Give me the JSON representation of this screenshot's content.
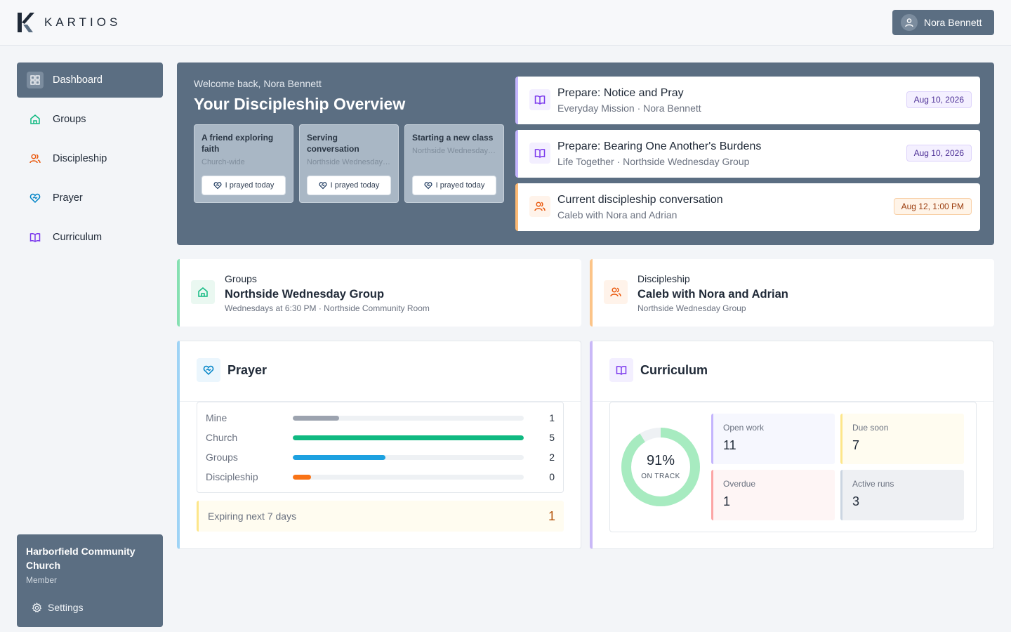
{
  "brand": {
    "name": "KARTIOS"
  },
  "user": {
    "name": "Nora Bennett"
  },
  "sidebar": {
    "items": [
      {
        "label": "Dashboard",
        "icon": "dashboard-icon",
        "active": true
      },
      {
        "label": "Groups",
        "icon": "home-icon"
      },
      {
        "label": "Discipleship",
        "icon": "users-icon"
      },
      {
        "label": "Prayer",
        "icon": "heart-hands-icon"
      },
      {
        "label": "Curriculum",
        "icon": "book-icon"
      }
    ],
    "org": {
      "name": "Harborfield Community Church",
      "role": "Member",
      "settings_label": "Settings"
    }
  },
  "hero": {
    "welcome": "Welcome back, Nora Bennett",
    "title": "Your Discipleship Overview",
    "prayer_cards": [
      {
        "title": "A friend exploring faith",
        "sub": "Church-wide",
        "button": "I prayed today"
      },
      {
        "title": "Serving conversation",
        "sub": "Northside Wednesday Group",
        "button": "I prayed today"
      },
      {
        "title": "Starting a new class",
        "sub": "Northside Wednesday Group",
        "button": "I prayed today"
      }
    ],
    "events": [
      {
        "title": "Prepare: Notice and Pray",
        "sub": "Everyday Mission · Nora Bennett",
        "date": "Aug 10, 2026"
      },
      {
        "title": "Prepare: Bearing One Another's Burdens",
        "sub": "Life Together · Northside Wednesday Group",
        "date": "Aug 10, 2026"
      },
      {
        "title": "Current discipleship conversation",
        "sub": "Caleb with Nora and Adrian",
        "date": "Aug 12, 1:00 PM"
      }
    ]
  },
  "groups_card": {
    "label": "Groups",
    "title": "Northside Wednesday Group",
    "sub": "Wednesdays at 6:30 PM · Northside Community Room"
  },
  "discipleship_card": {
    "label": "Discipleship",
    "title": "Caleb with Nora and Adrian",
    "sub": "Northside Wednesday Group"
  },
  "prayer": {
    "title": "Prayer",
    "max": 5,
    "rows": [
      {
        "label": "Mine",
        "value": "1",
        "color": "#9ca3af"
      },
      {
        "label": "Church",
        "value": "5",
        "color": "#10b981"
      },
      {
        "label": "Groups",
        "value": "2",
        "color": "#1da1e0"
      },
      {
        "label": "Discipleship",
        "value": "0",
        "color": "#f97316"
      }
    ],
    "expiring": {
      "label": "Expiring next 7 days",
      "value": "1"
    }
  },
  "curriculum": {
    "title": "Curriculum",
    "on_track_pct": "91%",
    "on_track_value": 91,
    "on_track_label": "ON TRACK",
    "tiles": [
      {
        "label": "Open work",
        "value": "11",
        "bg": "#f6f7fe",
        "border": "#c4b5fd"
      },
      {
        "label": "Due soon",
        "value": "7",
        "bg": "#fffcf0",
        "border": "#fde68a"
      },
      {
        "label": "Overdue",
        "value": "1",
        "bg": "#fef5f5",
        "border": "#fca5a5"
      },
      {
        "label": "Active runs",
        "value": "3",
        "bg": "#eef0f3",
        "border": "#cbd5e1"
      }
    ]
  }
}
